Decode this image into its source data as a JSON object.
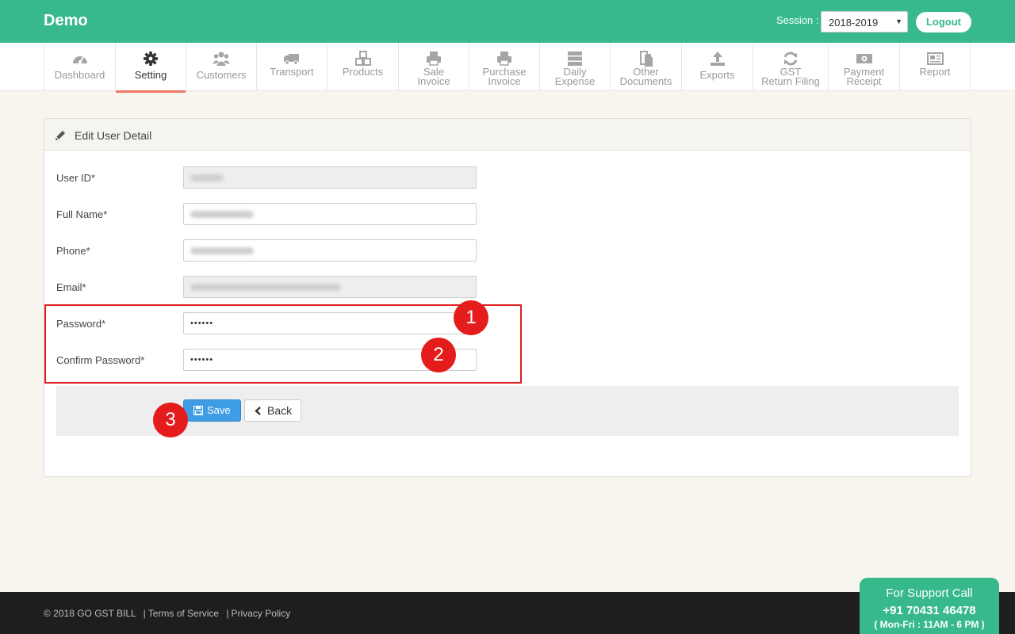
{
  "header": {
    "brand": "Demo",
    "session_label": "Session :",
    "session_value": "2018-2019",
    "logout_label": "Logout"
  },
  "nav": {
    "items": [
      {
        "label": "Dashboard",
        "icon": "dashboard-gauge-icon"
      },
      {
        "label": "Setting",
        "icon": "gear-icon",
        "active": true
      },
      {
        "label": "Customers",
        "icon": "users-icon"
      },
      {
        "label": "Transport",
        "icon": "truck-icon"
      },
      {
        "label": "Products",
        "icon": "cubes-icon"
      },
      {
        "label_line1": "Sale",
        "label_line2": "Invoice",
        "icon": "printer-icon"
      },
      {
        "label_line1": "Purchase",
        "label_line2": "Invoice",
        "icon": "printer-icon"
      },
      {
        "label_line1": "Daily",
        "label_line2": "Expense",
        "icon": "server-icon"
      },
      {
        "label_line1": "Other",
        "label_line2": "Documents",
        "icon": "documents-icon"
      },
      {
        "label": "Exports",
        "icon": "upload-icon"
      },
      {
        "label_line1": "GST",
        "label_line2": "Return Filing",
        "icon": "refresh-icon"
      },
      {
        "label_line1": "Payment",
        "label_line2": "Receipt",
        "icon": "money-icon"
      },
      {
        "label": "Report",
        "icon": "newspaper-icon"
      }
    ]
  },
  "panel": {
    "title": "Edit User Detail",
    "fields": {
      "user_id_label": "User ID*",
      "full_name_label": "Full Name*",
      "phone_label": "Phone*",
      "email_label": "Email*",
      "password_label": "Password*",
      "password_value": "••••••",
      "confirm_label": "Confirm Password*",
      "confirm_value": "••••••"
    },
    "save_label": "Save",
    "back_label": "Back"
  },
  "markers": [
    "1",
    "2",
    "3"
  ],
  "footer": {
    "copyright": "© 2018 GO GST BILL",
    "terms": "Terms of Service",
    "privacy": "Privacy Policy",
    "separator": "|"
  },
  "support": {
    "line1": "For Support Call",
    "phone": "+91 70431 46478",
    "hours": "( Mon-Fri : 11AM - 6 PM )"
  },
  "colors": {
    "brand_green": "#37b98b",
    "active_underline": "#ef7866",
    "save_blue": "#3f9de6",
    "marker_red": "#e51c1c"
  }
}
